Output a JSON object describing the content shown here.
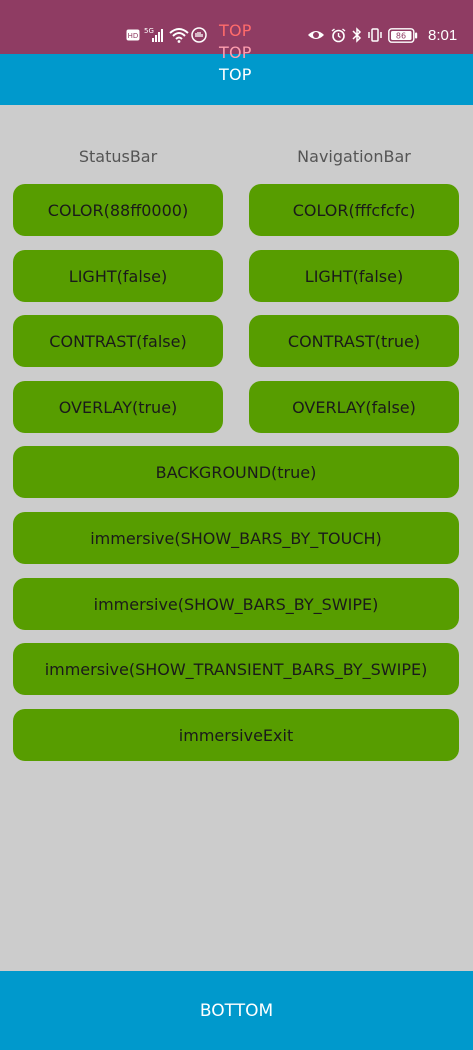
{
  "status_bar": {
    "time": "8:01",
    "battery_level": "86",
    "network": "5G",
    "hd_badge": "HD",
    "background_color": "#8f3c63",
    "icons": [
      "hd-icon",
      "signal-icon",
      "wifi-icon",
      "gesture-icon",
      "eye-icon",
      "alarm-icon",
      "bluetooth-icon",
      "vibrate-icon",
      "battery-icon"
    ]
  },
  "top_labels": [
    {
      "text": "TOP",
      "color": "#ff6b6b"
    },
    {
      "text": "TOP",
      "color": "#ff9fb0"
    },
    {
      "text": "TOP",
      "color": "#ffffff"
    }
  ],
  "colors": {
    "header_blue": "#0099cc",
    "button_green": "#579d00",
    "background": "#cccccc"
  },
  "columns": {
    "statusbar_header": "StatusBar",
    "navigationbar_header": "NavigationBar"
  },
  "buttons": {
    "sb_color": "COLOR(88ff0000)",
    "nb_color": "COLOR(fffcfcfc)",
    "sb_light": "LIGHT(false)",
    "nb_light": "LIGHT(false)",
    "sb_contrast": "CONTRAST(false)",
    "nb_contrast": "CONTRAST(true)",
    "sb_overlay": "OVERLAY(true)",
    "nb_overlay": "OVERLAY(false)",
    "background": "BACKGROUND(true)",
    "immersive_touch": "immersive(SHOW_BARS_BY_TOUCH)",
    "immersive_swipe": "immersive(SHOW_BARS_BY_SWIPE)",
    "immersive_transient": "immersive(SHOW_TRANSIENT_BARS_BY_SWIPE)",
    "immersive_exit": "immersiveExit"
  },
  "bottom": {
    "label": "BOTTOM"
  }
}
